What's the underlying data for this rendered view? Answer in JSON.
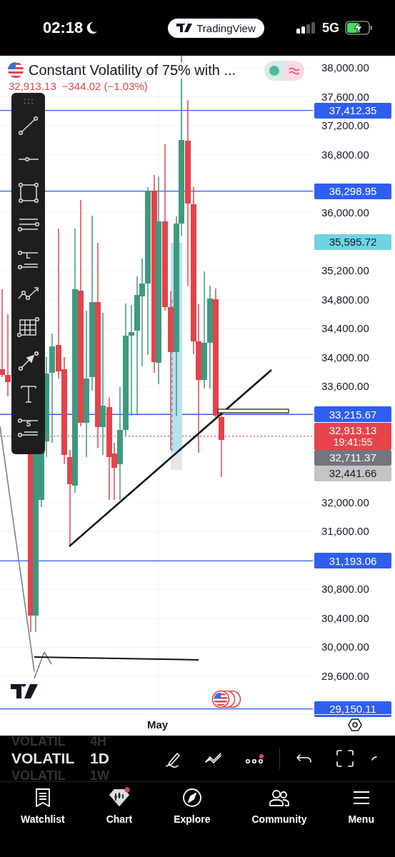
{
  "status_bar": {
    "time": "02:18",
    "app_pill": "TradingView",
    "network": "5G"
  },
  "symbol": {
    "title": "Constant Volatility of 75% with ...",
    "price": "32,913.13",
    "change": "−344.02 (−1.03%)"
  },
  "drawing_tools": [
    {
      "kind": "trend_line"
    },
    {
      "kind": "horizontal_ray"
    },
    {
      "kind": "rectangle"
    },
    {
      "kind": "channel"
    },
    {
      "kind": "labelled_lines",
      "letter": "L"
    },
    {
      "kind": "path"
    },
    {
      "kind": "grid"
    },
    {
      "kind": "arrow"
    },
    {
      "kind": "text"
    },
    {
      "kind": "labelled_lines",
      "letter": "S"
    }
  ],
  "price_axis": {
    "ticks": [
      "38,000.00",
      "37,600.00",
      "37,200.00",
      "36,800.00",
      "36,000.00",
      "35,200.00",
      "34,800.00",
      "34,400.00",
      "34,000.00",
      "33,600.00",
      "32,000.00",
      "31,600.00",
      "30,800.00",
      "30,400.00",
      "30,000.00",
      "29,600.00"
    ],
    "markers": [
      {
        "text": "37,412.35",
        "color": "#2f5ef0",
        "kind": "level"
      },
      {
        "text": "36,298.95",
        "color": "#2f5ef0",
        "kind": "level"
      },
      {
        "text": "35,595.72",
        "color": "#6fd3e3",
        "kind": "plain"
      },
      {
        "text": "33,215.67",
        "color": "#2f5ef0",
        "kind": "level"
      },
      {
        "text": "32,913.13",
        "sub": "19:41:55",
        "color": "#e5434b",
        "kind": "last_price"
      },
      {
        "text": "32,711.37",
        "color": "#74767d",
        "kind": "plain"
      },
      {
        "text": "32,441.66",
        "color": "#c4c4c4",
        "kind": "plain"
      },
      {
        "text": "31,193.06",
        "color": "#2f5ef0",
        "kind": "level"
      },
      {
        "text": "29,150.11",
        "color": "#2f5ef0",
        "kind": "level"
      }
    ]
  },
  "time_axis": {
    "labels": [
      "May"
    ]
  },
  "bottom_toolbar": {
    "symbol_wheel": [
      {
        "symbol": "VOLATIL",
        "interval": "4H",
        "selected": false
      },
      {
        "symbol": "VOLATIL",
        "interval": "1D",
        "selected": true
      },
      {
        "symbol": "VOLATIL",
        "interval": "1W",
        "selected": false
      }
    ],
    "tools": [
      {
        "kind": "pen"
      },
      {
        "kind": "wave"
      },
      {
        "kind": "more",
        "badge": true
      },
      {
        "kind": "undo"
      },
      {
        "kind": "fullscreen"
      },
      {
        "kind": "cut"
      }
    ]
  },
  "tab_bar": [
    {
      "label": "Watchlist",
      "kind": "watchlist",
      "badge": false
    },
    {
      "label": "Chart",
      "kind": "chart",
      "badge": true
    },
    {
      "label": "Explore",
      "kind": "explore",
      "badge": false
    },
    {
      "label": "Community",
      "kind": "community",
      "badge": false
    },
    {
      "label": "Menu",
      "kind": "menu",
      "badge": false
    }
  ]
}
